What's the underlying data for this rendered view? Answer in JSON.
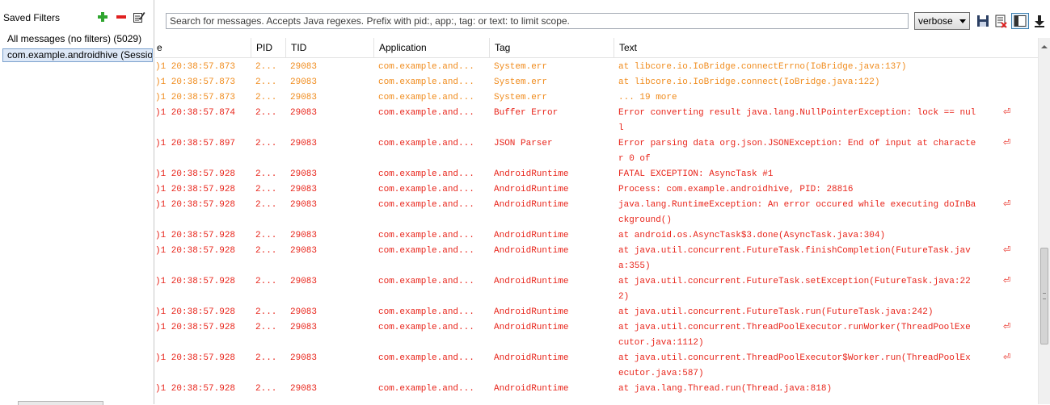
{
  "saved_filters": {
    "title": "Saved Filters",
    "items": [
      {
        "label": "All messages (no filters) (5029)"
      },
      {
        "label": "com.example.androidhive (Session"
      }
    ]
  },
  "toolbar": {
    "search_placeholder": "Search for messages. Accepts Java regexes. Prefix with pid:, app:, tag: or text: to limit scope.",
    "log_level": "verbose"
  },
  "columns": [
    "e",
    "PID",
    "TID",
    "Application",
    "Tag",
    "Text"
  ],
  "rows": [
    {
      "time": ")1 20:38:57.873",
      "pid": "2...",
      "tid": "29083",
      "app": "com.example.and...",
      "tag": "System.err",
      "text": "at libcore.io.IoBridge.connectErrno(IoBridge.java:137)",
      "level": "warn"
    },
    {
      "time": ")1 20:38:57.873",
      "pid": "2...",
      "tid": "29083",
      "app": "com.example.and...",
      "tag": "System.err",
      "text": "at libcore.io.IoBridge.connect(IoBridge.java:122)",
      "level": "warn"
    },
    {
      "time": ")1 20:38:57.873",
      "pid": "2...",
      "tid": "29083",
      "app": "com.example.and...",
      "tag": "System.err",
      "text": "... 19 more",
      "level": "warn"
    },
    {
      "time": ")1 20:38:57.874",
      "pid": "2...",
      "tid": "29083",
      "app": "com.example.and...",
      "tag": "Buffer Error",
      "text": "Error converting result java.lang.NullPointerException: lock == nul",
      "text2": "l",
      "level": "err"
    },
    {
      "time": ")1 20:38:57.897",
      "pid": "2...",
      "tid": "29083",
      "app": "com.example.and...",
      "tag": "JSON Parser",
      "text": "Error parsing data org.json.JSONException: End of input at characte",
      "text2": "r 0 of",
      "level": "err"
    },
    {
      "time": ")1 20:38:57.928",
      "pid": "2...",
      "tid": "29083",
      "app": "com.example.and...",
      "tag": "AndroidRuntime",
      "text": "FATAL EXCEPTION: AsyncTask #1",
      "level": "err"
    },
    {
      "time": ")1 20:38:57.928",
      "pid": "2...",
      "tid": "29083",
      "app": "com.example.and...",
      "tag": "AndroidRuntime",
      "text": "Process: com.example.androidhive, PID: 28816",
      "level": "err"
    },
    {
      "time": ")1 20:38:57.928",
      "pid": "2...",
      "tid": "29083",
      "app": "com.example.and...",
      "tag": "AndroidRuntime",
      "text": "java.lang.RuntimeException: An error occured while executing doInBa",
      "text2": "ckground()",
      "level": "err"
    },
    {
      "time": ")1 20:38:57.928",
      "pid": "2...",
      "tid": "29083",
      "app": "com.example.and...",
      "tag": "AndroidRuntime",
      "text": "at android.os.AsyncTask$3.done(AsyncTask.java:304)",
      "level": "err"
    },
    {
      "time": ")1 20:38:57.928",
      "pid": "2...",
      "tid": "29083",
      "app": "com.example.and...",
      "tag": "AndroidRuntime",
      "text": "at java.util.concurrent.FutureTask.finishCompletion(FutureTask.jav",
      "text2": "a:355)",
      "level": "err"
    },
    {
      "time": ")1 20:38:57.928",
      "pid": "2...",
      "tid": "29083",
      "app": "com.example.and...",
      "tag": "AndroidRuntime",
      "text": "at java.util.concurrent.FutureTask.setException(FutureTask.java:22",
      "text2": "2)",
      "level": "err"
    },
    {
      "time": ")1 20:38:57.928",
      "pid": "2...",
      "tid": "29083",
      "app": "com.example.and...",
      "tag": "AndroidRuntime",
      "text": "at java.util.concurrent.FutureTask.run(FutureTask.java:242)",
      "level": "err"
    },
    {
      "time": ")1 20:38:57.928",
      "pid": "2...",
      "tid": "29083",
      "app": "com.example.and...",
      "tag": "AndroidRuntime",
      "text": "at java.util.concurrent.ThreadPoolExecutor.runWorker(ThreadPoolExe",
      "text2": "cutor.java:1112)",
      "level": "err"
    },
    {
      "time": ")1 20:38:57.928",
      "pid": "2...",
      "tid": "29083",
      "app": "com.example.and...",
      "tag": "AndroidRuntime",
      "text": "at java.util.concurrent.ThreadPoolExecutor$Worker.run(ThreadPoolEx",
      "text2": "ecutor.java:587)",
      "level": "err"
    },
    {
      "time": ")1 20:38:57.928",
      "pid": "2...",
      "tid": "29083",
      "app": "com.example.and...",
      "tag": "AndroidRuntime",
      "text": "at java.lang.Thread.run(Thread.java:818)",
      "level": "err"
    }
  ],
  "colors": {
    "warn": "#f08c1e",
    "error": "#e8251b",
    "selection": "#dde8f7"
  },
  "icons": {
    "add": "plus-icon",
    "remove": "minus-icon",
    "edit": "edit-icon",
    "save": "save-icon",
    "clear": "clear-log-icon",
    "toggle": "toggle-filters-icon",
    "scroll": "scroll-to-end-icon",
    "wrap": "soft-wrap-icon"
  }
}
